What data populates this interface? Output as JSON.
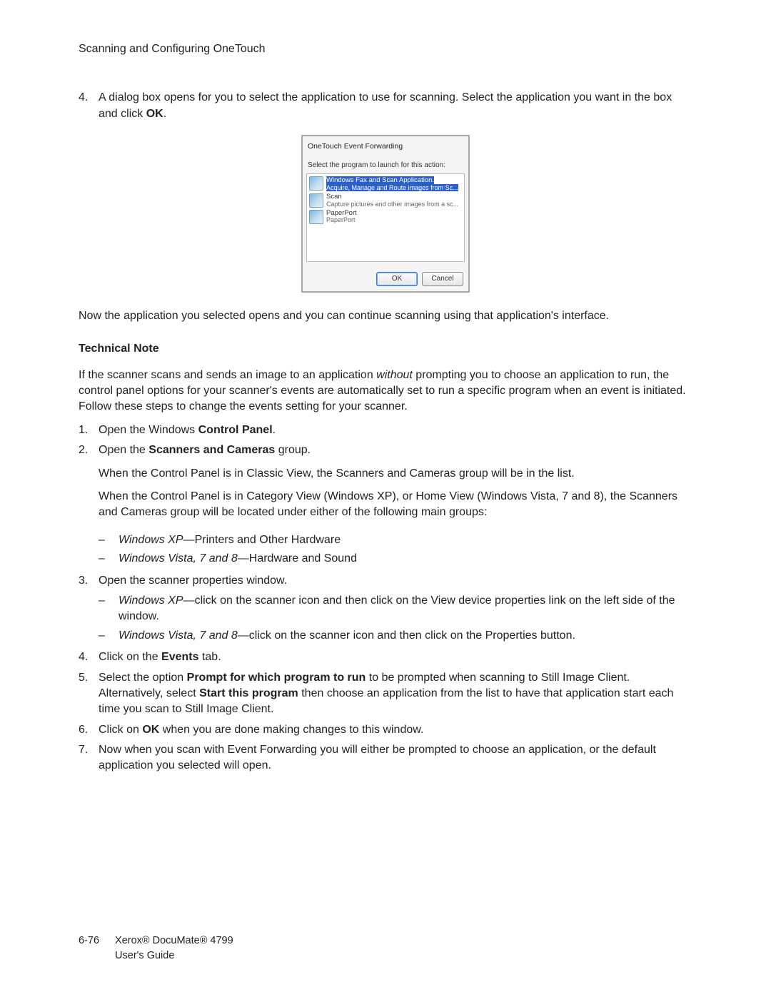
{
  "header": "Scanning and Configuring OneTouch",
  "step4": {
    "num": "4.",
    "text_a": "A dialog box opens for you to select the application to use for scanning. Select the application you want in the box and click ",
    "text_b": "OK",
    "text_c": "."
  },
  "dialog": {
    "title": "OneTouch Event Forwarding",
    "prompt": "Select the program to launch for this action:",
    "items": [
      {
        "title": "Windows Fax and Scan Application.",
        "sub": "Acquire, Manage and Route images from Sc...",
        "selected": true
      },
      {
        "title": "Scan",
        "sub": "Capture pictures and other images from a sc...",
        "selected": false
      },
      {
        "title": "PaperPort",
        "sub": "PaperPort",
        "selected": false
      }
    ],
    "ok": "OK",
    "cancel": "Cancel"
  },
  "post_dialog": "Now the application you selected opens and you can continue scanning using that application's interface.",
  "tech_note_heading": "Technical Note",
  "tech_note_body_a": "If the scanner scans and sends an image to an application ",
  "tech_note_body_b": "without",
  "tech_note_body_c": " prompting you to choose an application to run, the control panel options for your scanner's events are automatically set to run a specific program when an event is initiated. Follow these steps to change the events setting for your scanner.",
  "steps": {
    "s1": {
      "num": "1.",
      "a": "Open the Windows ",
      "b": "Control Panel",
      "c": "."
    },
    "s2": {
      "num": "2.",
      "a": "Open the ",
      "b": "Scanners and Cameras",
      "c": " group."
    },
    "s2_p1": "When the Control Panel is in Classic View, the Scanners and Cameras group will be in the list.",
    "s2_p2": "When the Control Panel is in Category View (Windows XP), or Home View (Windows Vista, 7 and 8), the Scanners and Cameras group will be located under either of the following main groups:",
    "s2_d1": {
      "a": "Windows XP",
      "b": "—Printers and Other Hardware"
    },
    "s2_d2": {
      "a": "Windows Vista, 7 and 8",
      "b": "—Hardware and Sound"
    },
    "s3": {
      "num": "3.",
      "a": "Open the scanner properties window."
    },
    "s3_d1": {
      "a": "Windows XP",
      "b": "—click on the scanner icon and then click on the View device properties link on the left side of the window."
    },
    "s3_d2": {
      "a": "Windows Vista, 7 and 8",
      "b": "—click on the scanner icon and then click on the Properties button."
    },
    "s4": {
      "num": "4.",
      "a": "Click on the ",
      "b": "Events",
      "c": " tab."
    },
    "s5": {
      "num": "5.",
      "a": "Select the option ",
      "b": "Prompt for which program to run",
      "c": " to be prompted when scanning to Still Image Client. Alternatively, select ",
      "d": "Start this program",
      "e": " then choose an application from the list to have that application start each time you scan to Still Image Client."
    },
    "s6": {
      "num": "6.",
      "a": "Click on ",
      "b": "OK",
      "c": " when you are done making changes to this window."
    },
    "s7": {
      "num": "7.",
      "a": "Now when you scan with Event Forwarding you will either be prompted to choose an application, or the default application you selected will open."
    }
  },
  "footer": {
    "pagenum": "6-76",
    "line1": "Xerox® DocuMate® 4799",
    "line2": "User's Guide"
  },
  "dash": "–"
}
